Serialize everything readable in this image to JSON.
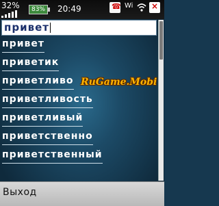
{
  "status_bar": {
    "battery_percent_text": "32%",
    "battery_icon_text": "83%",
    "time": "20:49",
    "icons": [
      "signal-icon",
      "battery-icon",
      "phone-icon",
      "wi-icon",
      "wifi-icon",
      "close-icon"
    ],
    "phone_icon_text": "☎",
    "wi_icon_text": "Wi",
    "close_icon_text": "×"
  },
  "search": {
    "value": "привет"
  },
  "results": [
    "привет",
    "приветик",
    "приветливо",
    "приветливость",
    "приветливый",
    "приветственно",
    "приветственный"
  ],
  "watermark_text": "RuGame.Mobi",
  "softkeys": {
    "left_label": "Выход"
  },
  "colors": {
    "background": "#1c4a66",
    "status_bar": "#111111",
    "softkey_bar": "#c8c8c8",
    "watermark": "#ffb400",
    "text": "#ffffff"
  }
}
